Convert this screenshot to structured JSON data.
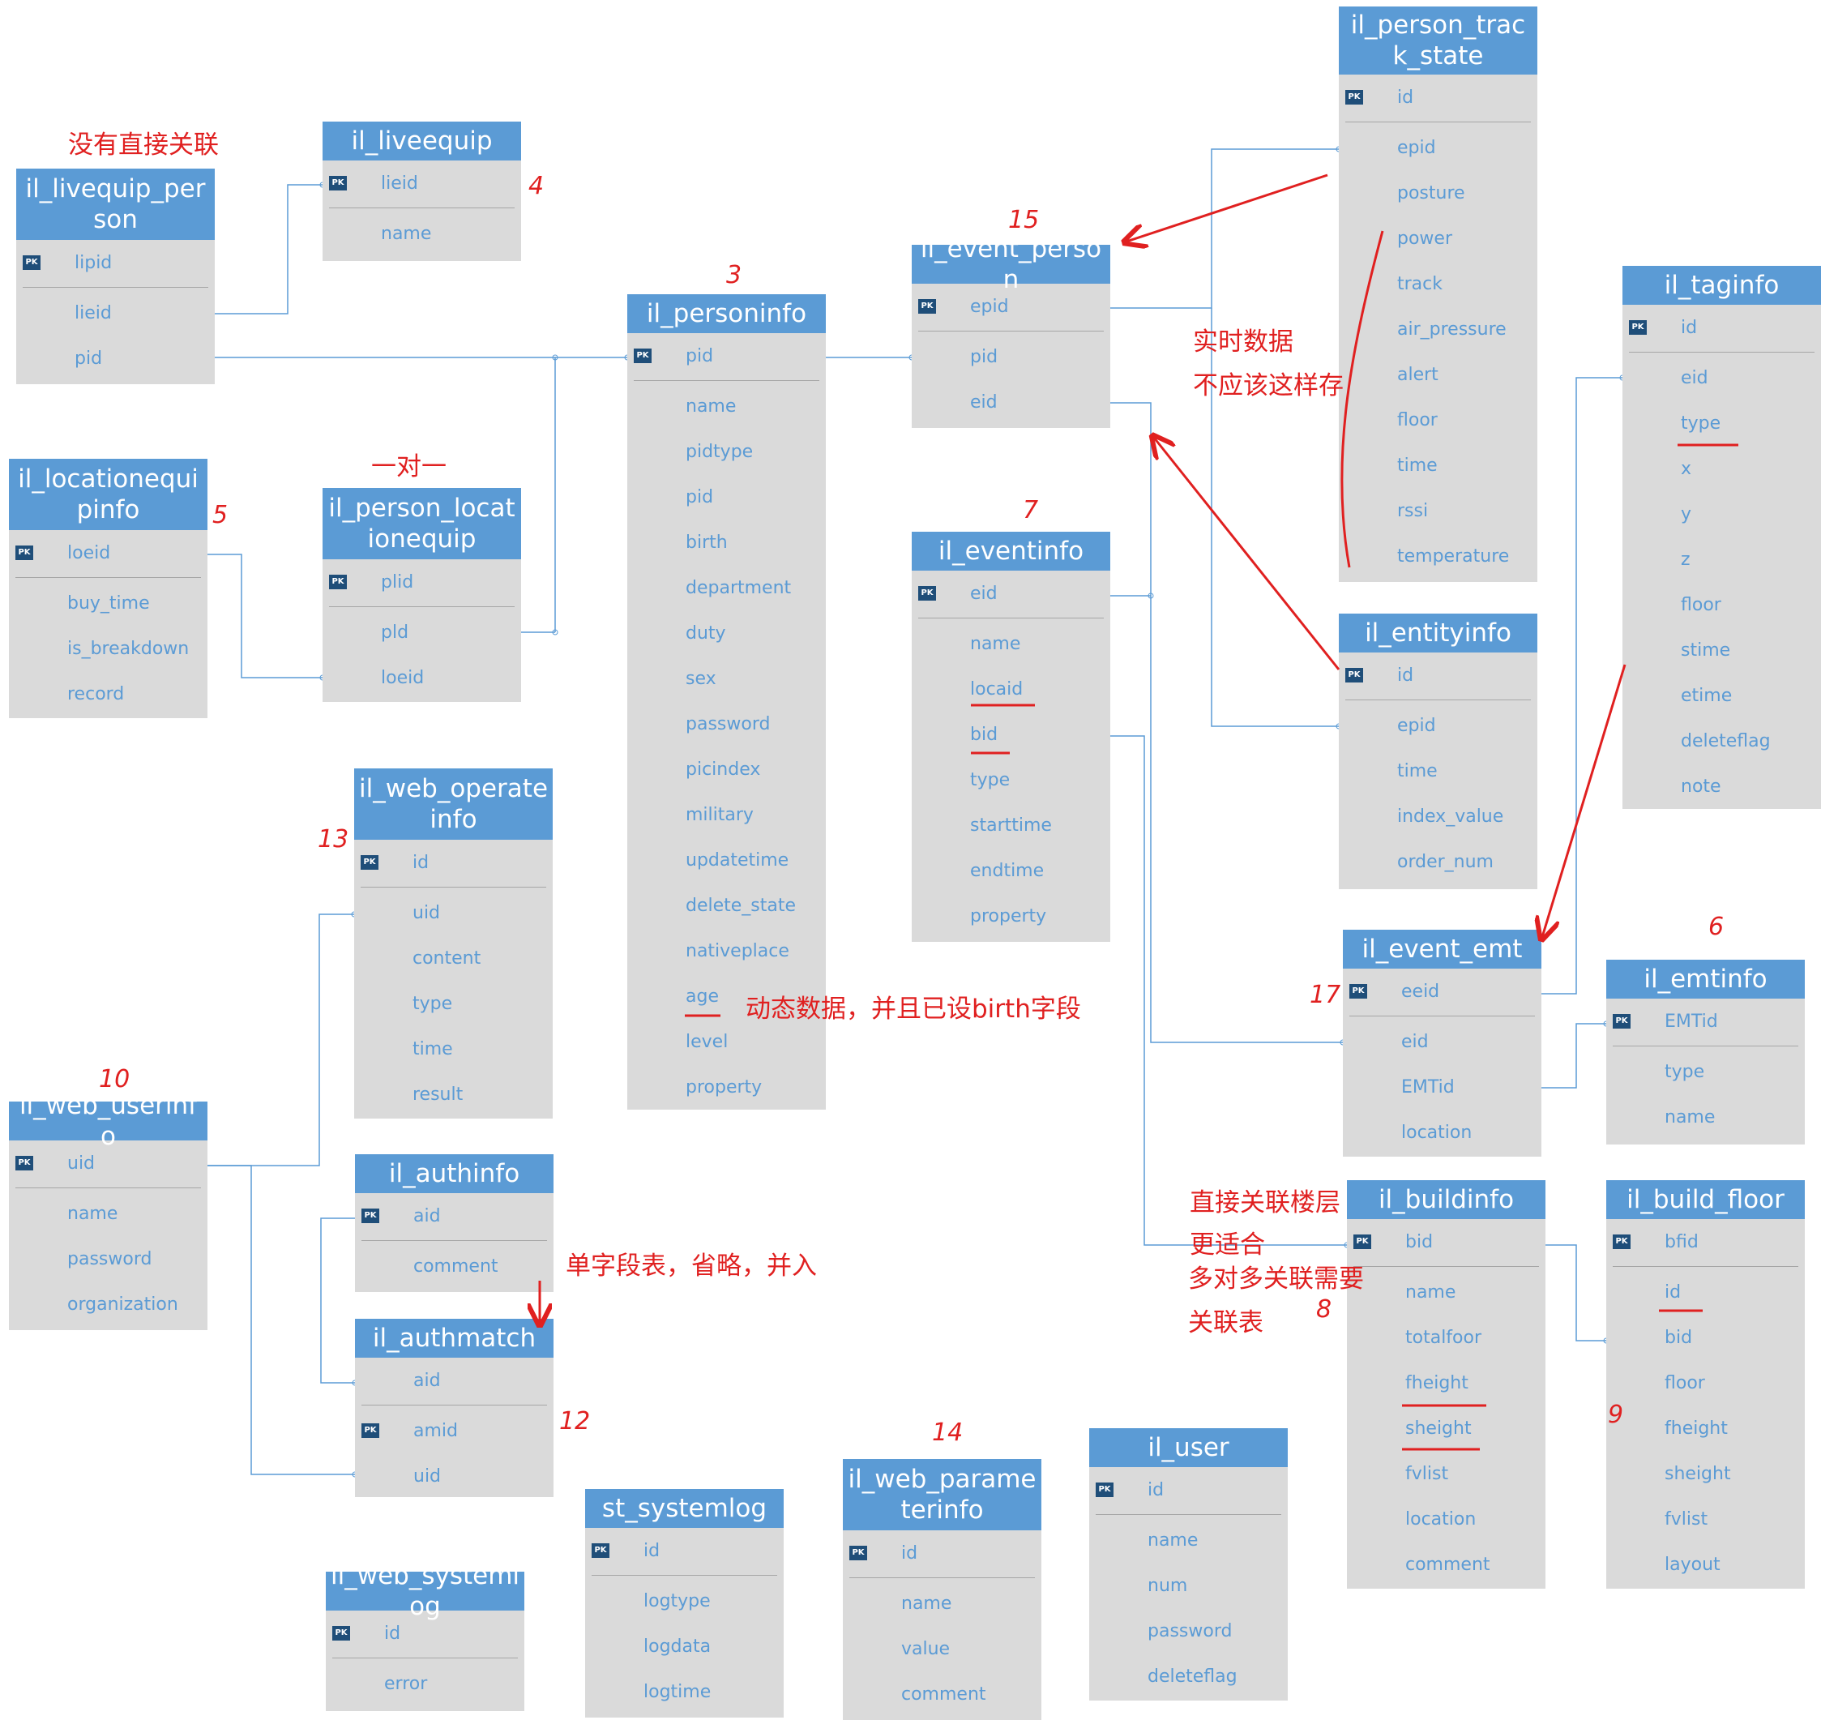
{
  "entities": [
    {
      "id": "livequip_person",
      "title": "il_livequip_person",
      "fields": [
        {
          "name": "lipid",
          "pk": true
        },
        {
          "name": "lieid"
        },
        {
          "name": "pid"
        }
      ]
    },
    {
      "id": "liveequip",
      "title": "il_liveequip",
      "fields": [
        {
          "name": "lieid",
          "pk": true
        },
        {
          "name": "name"
        }
      ]
    },
    {
      "id": "personinfo",
      "title": "il_personinfo",
      "fields": [
        {
          "name": "pid",
          "pk": true
        },
        {
          "name": "name"
        },
        {
          "name": "pidtype"
        },
        {
          "name": "pid"
        },
        {
          "name": "birth"
        },
        {
          "name": "department"
        },
        {
          "name": "duty"
        },
        {
          "name": "sex"
        },
        {
          "name": "password"
        },
        {
          "name": "picindex"
        },
        {
          "name": "military"
        },
        {
          "name": "updatetime"
        },
        {
          "name": "delete_state"
        },
        {
          "name": "nativeplace"
        },
        {
          "name": "age"
        },
        {
          "name": "level"
        },
        {
          "name": "property"
        }
      ]
    },
    {
      "id": "event_person",
      "title": "il_event_person",
      "fields": [
        {
          "name": "epid",
          "pk": true
        },
        {
          "name": "pid"
        },
        {
          "name": "eid"
        }
      ]
    },
    {
      "id": "person_track_state",
      "title": "il_person_track_state",
      "fields": [
        {
          "name": "id",
          "pk": true
        },
        {
          "name": "epid"
        },
        {
          "name": "posture"
        },
        {
          "name": "power"
        },
        {
          "name": "track"
        },
        {
          "name": "air_pressure"
        },
        {
          "name": "alert"
        },
        {
          "name": "floor"
        },
        {
          "name": "time"
        },
        {
          "name": "rssi"
        },
        {
          "name": "temperature"
        }
      ]
    },
    {
      "id": "taginfo",
      "title": "il_taginfo",
      "fields": [
        {
          "name": "id",
          "pk": true
        },
        {
          "name": "eid"
        },
        {
          "name": "type"
        },
        {
          "name": "x"
        },
        {
          "name": "y"
        },
        {
          "name": "z"
        },
        {
          "name": "floor"
        },
        {
          "name": "stime"
        },
        {
          "name": "etime"
        },
        {
          "name": "deleteflag"
        },
        {
          "name": "note"
        }
      ]
    },
    {
      "id": "locationequipinfo",
      "title": "il_locationequipinfo",
      "fields": [
        {
          "name": "loeid",
          "pk": true
        },
        {
          "name": "buy_time"
        },
        {
          "name": "is_breakdown"
        },
        {
          "name": "record"
        }
      ]
    },
    {
      "id": "person_locationequip",
      "title": "il_person_locationequip",
      "fields": [
        {
          "name": "plid",
          "pk": true
        },
        {
          "name": "pld"
        },
        {
          "name": "loeid"
        }
      ]
    },
    {
      "id": "eventinfo",
      "title": "il_eventinfo",
      "fields": [
        {
          "name": "eid",
          "pk": true
        },
        {
          "name": "name"
        },
        {
          "name": "locaid"
        },
        {
          "name": "bid"
        },
        {
          "name": "type"
        },
        {
          "name": "starttime"
        },
        {
          "name": "endtime"
        },
        {
          "name": "property"
        }
      ]
    },
    {
      "id": "entityinfo",
      "title": "il_entityinfo",
      "fields": [
        {
          "name": "id",
          "pk": true
        },
        {
          "name": "epid"
        },
        {
          "name": "time"
        },
        {
          "name": "index_value"
        },
        {
          "name": "order_num"
        }
      ]
    },
    {
      "id": "web_operateinfo",
      "title": "il_web_operateinfo",
      "fields": [
        {
          "name": "id",
          "pk": true
        },
        {
          "name": "uid"
        },
        {
          "name": "content"
        },
        {
          "name": "type"
        },
        {
          "name": "time"
        },
        {
          "name": "result"
        }
      ]
    },
    {
      "id": "event_emt",
      "title": "il_event_emt",
      "fields": [
        {
          "name": "eeid",
          "pk": true
        },
        {
          "name": "eid"
        },
        {
          "name": "EMTid"
        },
        {
          "name": "location"
        }
      ]
    },
    {
      "id": "emtinfo",
      "title": "il_emtinfo",
      "fields": [
        {
          "name": "EMTid",
          "pk": true
        },
        {
          "name": "type"
        },
        {
          "name": "name"
        }
      ]
    },
    {
      "id": "web_userinfo",
      "title": "il_web_userinfo",
      "fields": [
        {
          "name": "uid",
          "pk": true
        },
        {
          "name": "name"
        },
        {
          "name": "password"
        },
        {
          "name": "organization"
        }
      ]
    },
    {
      "id": "authinfo",
      "title": "il_authinfo",
      "fields": [
        {
          "name": "aid",
          "pk": true
        },
        {
          "name": "comment"
        }
      ]
    },
    {
      "id": "authmatch",
      "title": "il_authmatch",
      "fields": [
        {
          "name": "aid"
        },
        {
          "name": "amid",
          "pk": true
        },
        {
          "name": "uid"
        }
      ]
    },
    {
      "id": "buildinfo",
      "title": "il_buildinfo",
      "fields": [
        {
          "name": "bid",
          "pk": true
        },
        {
          "name": "name"
        },
        {
          "name": "totalfoor"
        },
        {
          "name": "fheight"
        },
        {
          "name": "sheight"
        },
        {
          "name": "fvlist"
        },
        {
          "name": "location"
        },
        {
          "name": "comment"
        }
      ]
    },
    {
      "id": "build_floor",
      "title": "il_build_floor",
      "fields": [
        {
          "name": "bfid",
          "pk": true
        },
        {
          "name": "id"
        },
        {
          "name": "bid"
        },
        {
          "name": "floor"
        },
        {
          "name": "fheight"
        },
        {
          "name": "sheight"
        },
        {
          "name": "fvlist"
        },
        {
          "name": "layout"
        }
      ]
    },
    {
      "id": "web_parameterinfo",
      "title": "il_web_parameterinfo",
      "fields": [
        {
          "name": "id",
          "pk": true
        },
        {
          "name": "name"
        },
        {
          "name": "value"
        },
        {
          "name": "comment"
        }
      ]
    },
    {
      "id": "user",
      "title": "il_user",
      "fields": [
        {
          "name": "id",
          "pk": true
        },
        {
          "name": "name"
        },
        {
          "name": "num"
        },
        {
          "name": "password"
        },
        {
          "name": "deleteflag"
        }
      ]
    },
    {
      "id": "st_systemlog",
      "title": "st_systemlog",
      "fields": [
        {
          "name": "id",
          "pk": true
        },
        {
          "name": "logtype"
        },
        {
          "name": "logdata"
        },
        {
          "name": "logtime"
        }
      ]
    },
    {
      "id": "web_systemlog",
      "title": "il_web_systemlog",
      "fields": [
        {
          "name": "id",
          "pk": true
        },
        {
          "name": "error"
        }
      ]
    }
  ],
  "pk_label": "PK",
  "notes": [
    {
      "id": "no_direct",
      "text": "没有直接关联"
    },
    {
      "id": "one_to_one",
      "text": "一对一"
    },
    {
      "id": "realtime_1",
      "text": "实时数据"
    },
    {
      "id": "realtime_2",
      "text": "不应该这样存"
    },
    {
      "id": "dynamic",
      "text": "动态数据，并且已设birth字段"
    },
    {
      "id": "single_field",
      "text": "单字段表，省略，并入"
    },
    {
      "id": "direct_floor_1",
      "text": "直接关联楼层"
    },
    {
      "id": "direct_floor_2",
      "text": "更适合"
    },
    {
      "id": "m2m_1",
      "text": "多对多关联需要"
    },
    {
      "id": "m2m_2",
      "text": "关联表"
    }
  ],
  "annotation_numbers": [
    {
      "id": "n4",
      "text": "4"
    },
    {
      "id": "n5",
      "text": "5"
    },
    {
      "id": "n3",
      "text": "3"
    },
    {
      "id": "n15",
      "text": "15"
    },
    {
      "id": "n7",
      "text": "7"
    },
    {
      "id": "n13",
      "text": "13"
    },
    {
      "id": "n10",
      "text": "10"
    },
    {
      "id": "n12",
      "text": "12"
    },
    {
      "id": "n14",
      "text": "14"
    },
    {
      "id": "n17",
      "text": "17"
    },
    {
      "id": "n6",
      "text": "6"
    },
    {
      "id": "n8",
      "text": "8"
    },
    {
      "id": "n9",
      "text": "9"
    }
  ],
  "colors": {
    "header": "#5b9bd5",
    "body": "#dadada",
    "field_text": "#5b9bd5",
    "connector": "#5b9bd5",
    "annotation": "#e02020",
    "pk_icon": "#1f4e79"
  }
}
